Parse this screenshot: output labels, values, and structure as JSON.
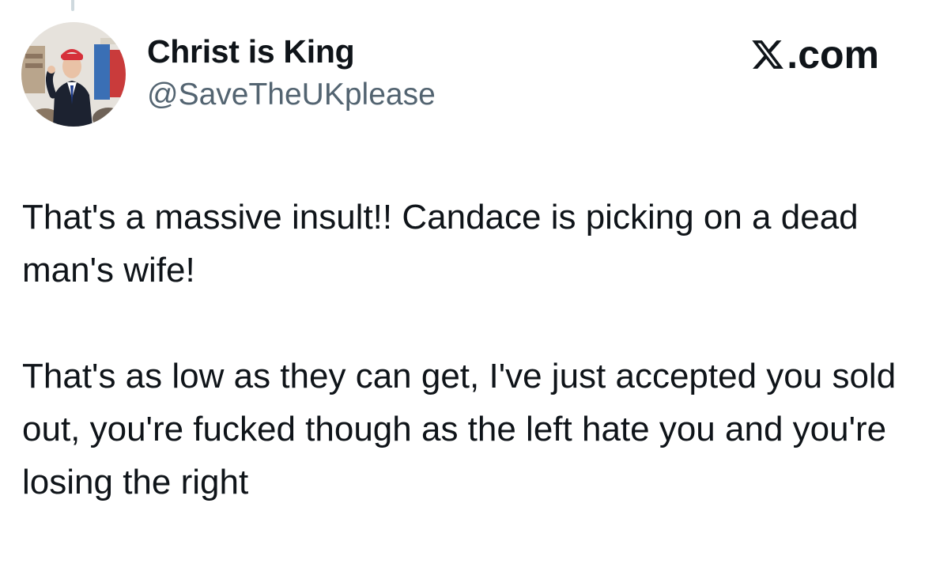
{
  "author": {
    "display_name": "Christ is King",
    "handle": "@SaveTheUKplease",
    "avatar_icon": "profile-photo"
  },
  "brand": {
    "logo_icon": "x-logo-icon",
    "text": ".com"
  },
  "tweet": {
    "paragraphs": [
      "That's a massive insult!! Candace is picking on a dead man's wife!",
      "That's as low as they can get, I've just accepted you sold out, you're fucked though as the left hate you and you're losing the right"
    ]
  },
  "colors": {
    "text_primary": "#0f1419",
    "text_secondary": "#536471",
    "thread_line": "#cfd9de"
  }
}
